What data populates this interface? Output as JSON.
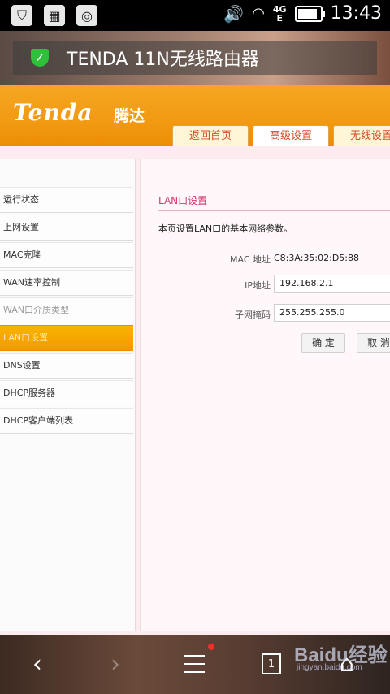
{
  "status_bar": {
    "time": "13:43",
    "network": "4G",
    "network_sub": "E",
    "battery_level": 0.78,
    "icons": [
      "notification-icon",
      "image-icon",
      "browser-icon",
      "volume-icon",
      "wifi-icon",
      "battery-icon"
    ]
  },
  "browser": {
    "page_title": "TENDA 11N无线路由器"
  },
  "router": {
    "logo": "Tenda",
    "logo_cn": "腾达",
    "tabs": [
      {
        "label": "返回首页"
      },
      {
        "label": "高级设置",
        "active": true
      },
      {
        "label": "无线设置"
      }
    ]
  },
  "sidebar": {
    "items": [
      {
        "label": "运行状态"
      },
      {
        "label": "上网设置"
      },
      {
        "label": "MAC克隆"
      },
      {
        "label": "WAN速率控制"
      },
      {
        "label": "WAN口介质类型",
        "disabled": true
      },
      {
        "label": "LAN口设置",
        "active": true
      },
      {
        "label": "DNS设置"
      },
      {
        "label": "DHCP服务器"
      },
      {
        "label": "DHCP客户端列表"
      }
    ]
  },
  "panel": {
    "title": "LAN口设置",
    "description": "本页设置LAN口的基本网络参数。",
    "mac_label": "MAC 地址",
    "mac_value": "C8:3A:35:02:D5:88",
    "ip_label": "IP地址",
    "ip_value": "192.168.2.1",
    "mask_label": "子网掩码",
    "mask_value": "255.255.255.0",
    "ok_label": "确 定",
    "cancel_label": "取 消"
  },
  "bottom_bar": {
    "tabs_count": "1",
    "watermark": "Baidu经验",
    "watermark_url": "jingyan.baidu.com"
  }
}
